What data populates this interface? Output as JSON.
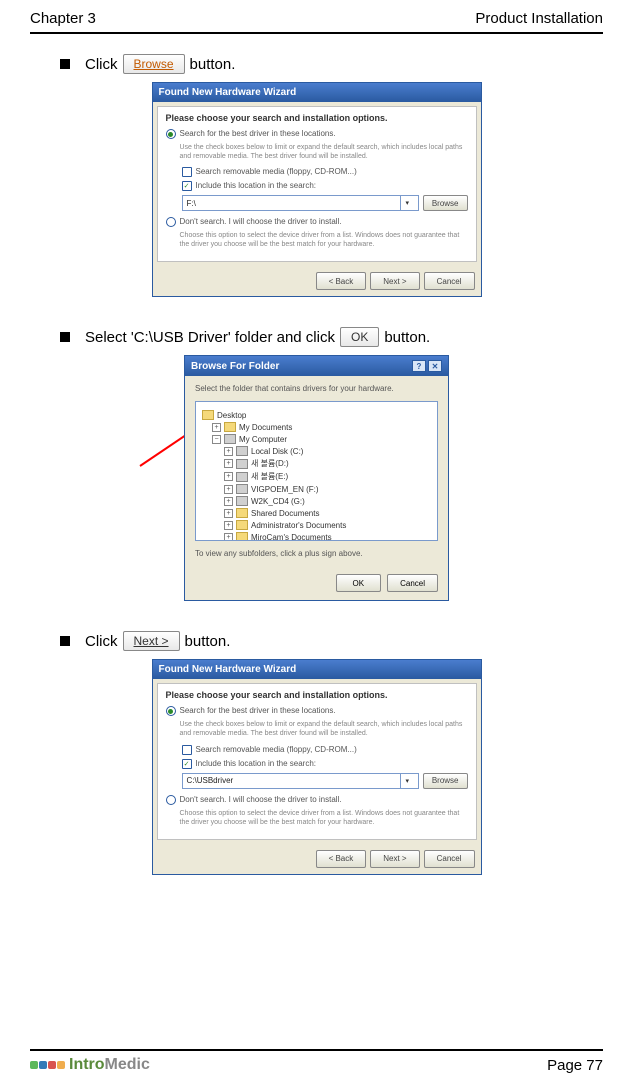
{
  "header": {
    "left": "Chapter 3",
    "right": "Product Installation"
  },
  "steps": {
    "s1_pre": "Click",
    "s1_btn": "Browse",
    "s1_post": " button.",
    "s2_pre": "Select 'C:\\USB Driver' folder and click",
    "s2_btn": "OK",
    "s2_post": " button.",
    "s3_pre": "Click",
    "s3_btn": "Next >",
    "s3_post": " button."
  },
  "wizard": {
    "title": "Found New Hardware Wizard",
    "subtitle": "Please choose your search and installation options.",
    "opt1": "Search for the best driver in these locations.",
    "opt1_desc": "Use the check boxes below to limit or expand the default search, which includes local paths and removable media. The best driver found will be installed.",
    "chk1": "Search removable media (floppy, CD-ROM...)",
    "chk2": "Include this location in the search:",
    "path1": "F:\\",
    "path2": "C:\\USBdriver",
    "browse_btn": "Browse",
    "opt2": "Don't search. I will choose the driver to install.",
    "opt2_desc": "Choose this option to select the device driver from a list. Windows does not guarantee that the driver you choose will be the best match for your hardware.",
    "back": "< Back",
    "next": "Next >",
    "cancel": "Cancel"
  },
  "browse_dlg": {
    "title": "Browse For Folder",
    "instr": "Select the folder that contains drivers for your hardware.",
    "items": {
      "desktop": "Desktop",
      "mydocs": "My Documents",
      "mycomp": "My Computer",
      "localc": "Local Disk (C:)",
      "driveD": "새 볼륨(D:)",
      "driveE": "새 볼륨(E:)",
      "driveF": "VIGPOEM_EN (F:)",
      "driveG": "W2K_CD4 (G:)",
      "shared": "Shared Documents",
      "admin": "Administrator's Documents",
      "miro": "MiroCam's Documents"
    },
    "note": "To view any subfolders, click a plus sign above.",
    "ok": "OK",
    "cancel": "Cancel"
  },
  "footer": {
    "page": "Page 77",
    "logo1": "Intro",
    "logo2": "Medic"
  }
}
